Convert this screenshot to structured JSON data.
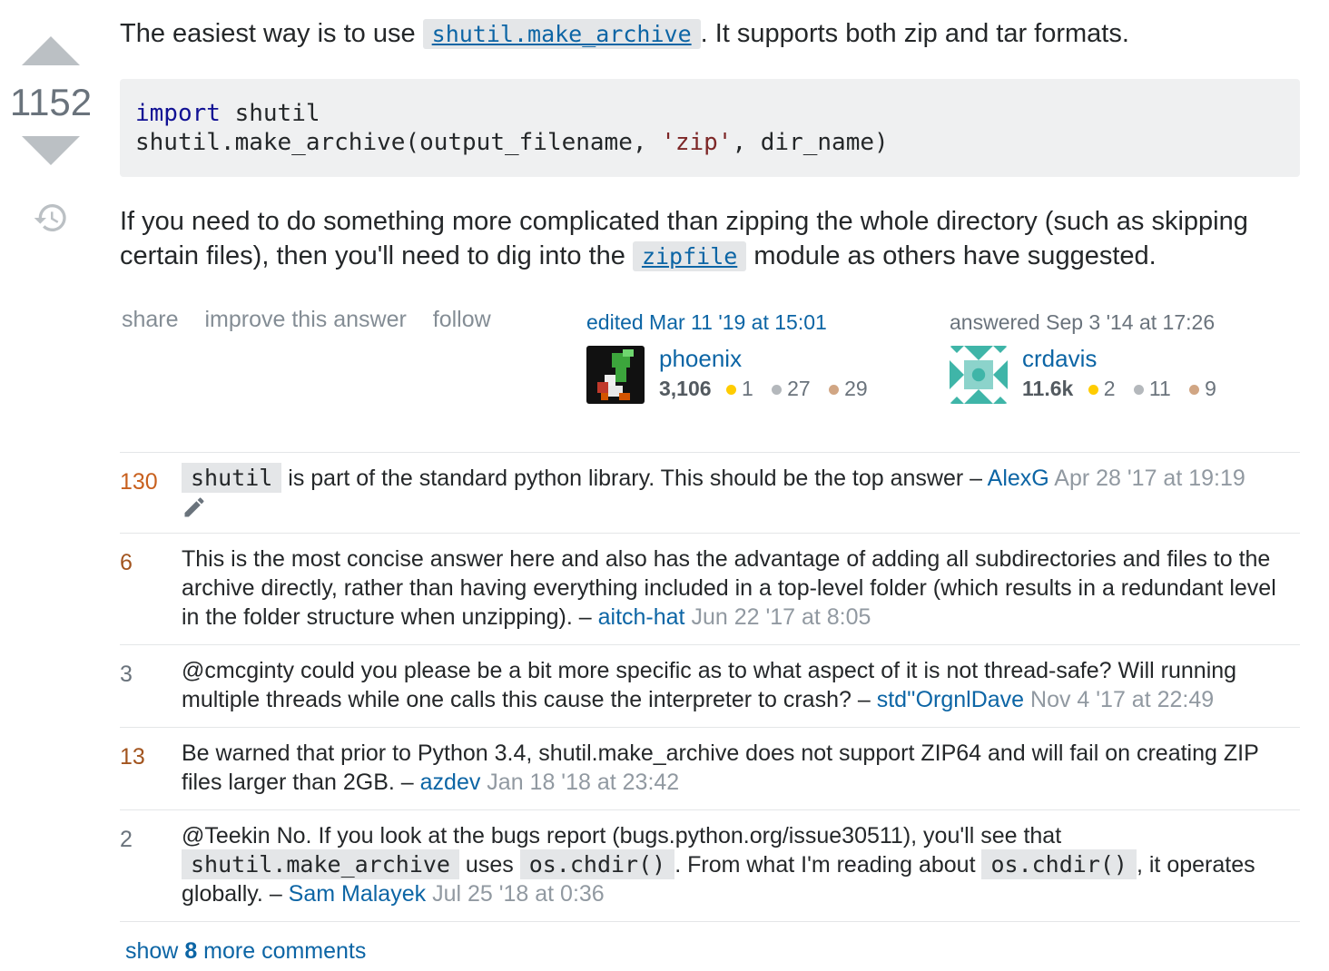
{
  "vote": {
    "score": "1152"
  },
  "post": {
    "para1_before": "The easiest way is to use ",
    "para1_code": "shutil.make_archive",
    "para1_after": ". It supports both zip and tar formats.",
    "code_line1_kw": "import",
    "code_line1_rest": " shutil",
    "code_line2_a": "shutil.make_archive(output_filename, ",
    "code_line2_str": "'zip'",
    "code_line2_b": ", dir_name)",
    "para2_before": "If you need to do something more complicated than zipping the whole directory (such as skipping certain files), then you'll need to dig into the ",
    "para2_code": "zipfile",
    "para2_after": " module as others have suggested."
  },
  "menu": {
    "share": "share",
    "improve": "improve this answer",
    "follow": "follow"
  },
  "editor": {
    "action": "edited Mar 11 '19 at 15:01",
    "name": "phoenix",
    "rep": "3,106",
    "gold": "1",
    "silver": "27",
    "bronze": "29"
  },
  "answerer": {
    "action": "answered Sep 3 '14 at 17:26",
    "name": "crdavis",
    "rep": "11.6k",
    "gold": "2",
    "silver": "11",
    "bronze": "9"
  },
  "colors": {
    "gold": "#ffcc01",
    "silver": "#b4b8bc",
    "bronze": "#d1a684",
    "link": "#0c65a5"
  },
  "comments": [
    {
      "score": "130",
      "code": "shutil",
      "text": " is part of the standard python library. This should be the top answer",
      "sep": " – ",
      "user": "AlexG",
      "date": " Apr 28 '17 at 19:19"
    },
    {
      "score": "6",
      "text": "This is the most concise answer here and also has the advantage of adding all subdirectories and files to the archive directly, rather than having everything included in a top-level folder (which results in a redundant level in the folder structure when unzipping).",
      "sep": " – ",
      "user": "aitch-hat",
      "date": " Jun 22 '17 at 8:05"
    },
    {
      "score": "3",
      "text": "@cmcginty could you please be a bit more specific as to what aspect of it is not thread-safe? Will running multiple threads while one calls this cause the interpreter to crash?",
      "sep": " – ",
      "user": "std''OrgnlDave",
      "date": " Nov 4 '17 at 22:49"
    },
    {
      "score": "13",
      "text": "Be warned that prior to Python 3.4, shutil.make_archive does not support ZIP64 and will fail on creating ZIP files larger than 2GB.",
      "sep": " – ",
      "user": "azdev",
      "date": " Jan 18 '18 at 23:42"
    },
    {
      "score": "2",
      "text_a": "@Teekin No. If you look at the bugs report (bugs.python.org/issue30511), you'll see that ",
      "code_a": "shutil.make_archive",
      "text_b": " uses ",
      "code_b": "os.chdir()",
      "text_c": ". From what I'm reading about ",
      "code_c": "os.chdir()",
      "text_d": ", it operates globally.",
      "sep": " – ",
      "user": "Sam Malayek",
      "date": " Jul 25 '18 at 0:36"
    }
  ],
  "score_colors": [
    "#c8601e",
    "#a2541e",
    "#6a737c",
    "#a2541e",
    "#6a737c"
  ],
  "show_more": {
    "prefix": "show ",
    "count": "8",
    "suffix": " more comments"
  }
}
